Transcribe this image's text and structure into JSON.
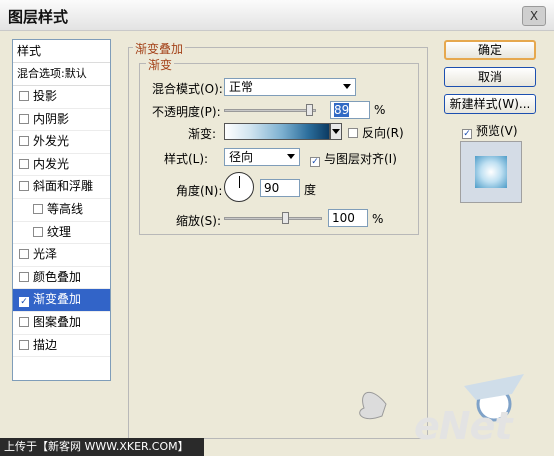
{
  "window": {
    "title": "图层样式",
    "close_label": "X"
  },
  "stylelist": {
    "header": "样式",
    "blend": "混合选项:默认",
    "items": [
      {
        "label": "投影",
        "checked": false
      },
      {
        "label": "内阴影",
        "checked": false
      },
      {
        "label": "外发光",
        "checked": false
      },
      {
        "label": "内发光",
        "checked": false
      },
      {
        "label": "斜面和浮雕",
        "checked": false
      },
      {
        "label": "等高线",
        "checked": false
      },
      {
        "label": "纹理",
        "checked": false
      },
      {
        "label": "光泽",
        "checked": false
      },
      {
        "label": "颜色叠加",
        "checked": false
      },
      {
        "label": "渐变叠加",
        "checked": true
      },
      {
        "label": "图案叠加",
        "checked": false
      },
      {
        "label": "描边",
        "checked": false
      }
    ]
  },
  "panel": {
    "group_title": "渐变叠加",
    "subgroup_title": "渐变",
    "blend_mode_label": "混合模式(O):",
    "blend_mode_value": "正常",
    "opacity_label": "不透明度(P):",
    "opacity_value": "89",
    "opacity_unit": "%",
    "gradient_label": "渐变:",
    "reverse_label": "反向(R)",
    "style_label": "样式(L):",
    "style_value": "径向",
    "align_label": "与图层对齐(I)",
    "angle_label": "角度(N):",
    "angle_value": "90",
    "angle_unit": "度",
    "scale_label": "缩放(S):",
    "scale_value": "100",
    "scale_unit": "%"
  },
  "buttons": {
    "ok": "确定",
    "cancel": "取消",
    "new_style": "新建样式(W)...",
    "preview": "预览(V)"
  },
  "footer": {
    "text": "上传于【新客网 WWW.XKER.COM】",
    "logo_text": "eNet"
  },
  "colors": {
    "accent": "#a4431a",
    "selection": "#3264c8"
  }
}
